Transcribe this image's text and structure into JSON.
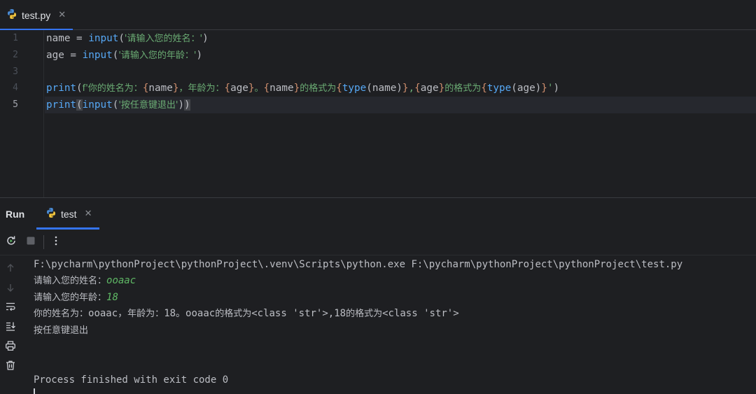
{
  "editor": {
    "tab": {
      "label": "test.py",
      "close": "✕"
    },
    "line_numbers": [
      "1",
      "2",
      "3",
      "4",
      "5"
    ],
    "lines": {
      "l1": {
        "a": "name = ",
        "b": "input",
        "c": "(",
        "d": "'请输入您的姓名：'",
        "e": ")"
      },
      "l2": {
        "a": "age = ",
        "b": "input",
        "c": "(",
        "d": "'请输入您的年龄：'",
        "e": ")"
      },
      "l4": {
        "p1": "print",
        "p2": "(",
        "p3": "f'你的姓名为：",
        "p4": "{",
        "p5": "name",
        "p6": "}",
        "p7": "，年龄为：",
        "p8": "{",
        "p9": "age",
        "p10": "}",
        "p11": "。",
        "p12": "{",
        "p13": "name",
        "p14": "}",
        "p15": "的格式为",
        "p16": "{",
        "p17": "type",
        "p18": "(name)",
        "p19": "}",
        "p20": ",",
        "p21": "{",
        "p22": "age",
        "p23": "}",
        "p24": "的格式为",
        "p25": "{",
        "p26": "type",
        "p27": "(age)",
        "p28": "}",
        "p29": "'",
        "p30": ")"
      },
      "l5": {
        "a": "print",
        "b": "(",
        "c": "input",
        "d": "(",
        "e": "'按任意键退出'",
        "f": ")",
        "g": ")"
      }
    }
  },
  "run": {
    "title": "Run",
    "tab": {
      "label": "test",
      "close": "✕"
    },
    "console": {
      "cmd": "F:\\pycharm\\pythonProject\\pythonProject\\.venv\\Scripts\\python.exe F:\\pycharm\\pythonProject\\pythonProject\\test.py",
      "prompt_name": "请输入您的姓名：",
      "input_name": "ooaac",
      "prompt_age": "请输入您的年龄：",
      "input_age": "18",
      "result_a": "你的姓名为：",
      "result_b": "ooaac，",
      "result_c": "年龄为：",
      "result_d": "18。ooaac",
      "result_e": "的格式为",
      "result_f": "<class 'str'>,18",
      "result_g": "的格式为",
      "result_h": "<class 'str'>",
      "exit_prompt": "按任意键退出",
      "finished": "Process finished with exit code 0"
    }
  },
  "colors": {
    "background": "#1e1f22",
    "keyword": "#56a8f5",
    "string": "#6aab73",
    "format_brace": "#cf8e6d",
    "user_input": "#5fb865",
    "accent": "#3574f0"
  },
  "icons": {
    "file": "python-file-icon",
    "run_tab": "python-file-icon",
    "toolbar": [
      "rerun-icon",
      "stop-icon",
      "more-vertical-icon"
    ],
    "side": [
      "arrow-up-icon",
      "arrow-down-icon",
      "soft-wrap-icon",
      "scroll-to-end-icon",
      "print-icon",
      "trash-icon"
    ]
  }
}
